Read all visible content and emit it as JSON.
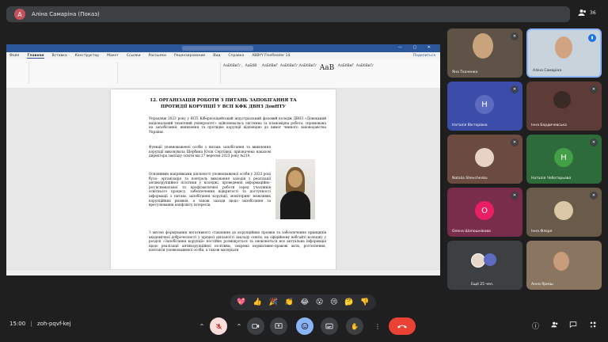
{
  "presenter": {
    "initial": "А",
    "label": "Аліна Самаріна (Показ)"
  },
  "participant_count": "36",
  "word": {
    "tabs": [
      "Файл",
      "Главная",
      "Вставка",
      "Конструктор",
      "Макет",
      "Ссылки",
      "Рассылки",
      "Рецензирование",
      "Вид",
      "Справка",
      "ABBYY FineReader 14"
    ],
    "share_label": "Поделиться",
    "styles": [
      "АаБбВвГг,",
      "АаБбВ",
      "АаБбВвГ",
      "АаБбВвГг,",
      "АаБбВвГг",
      "AaB",
      "АаБбВвГ",
      "АаБбВвГг"
    ],
    "heading_line1": "12. ОРГАНІЗАЦІЯ РОБОТИ З ПИТАНЬ ЗАПОБІГАННЯ ТА",
    "heading_line2": "ПРОТИДІЇ КОРУПЦІЇ У ВСП КФК ДВНЗ ДонНТУ",
    "para1": "Упродовж 2023 року у ВСП Кіберполіцейський індустріальний фаховий коледж ДВНЗ «Донецький національний технічний університет» здійснювалась системна та планомірна робота, спрямована на запобігання, виявлення та протидію корупції відповідно до вимог чинного законодавства України.",
    "para2": "Функції уповноваженої особи з питань запобігання та виявлення корупції виконувала Щербина Юлія Сергіївна, призначена наказом директора закладу освіти від 27 вересня 2023 року №210.",
    "para3": "Основними напрямками діяльності уповноваженої особи у 2023 році було: організація та контроль виконання заходів з реалізації антикорупційної політики у коледжі, проведення інформаційно-роз'яснювальної та профілактичної роботи серед учасників освітнього процесу, забезпечення відкритості та доступності інформації з питань запобігання корупції, моніторинг можливих корупційних ризиків, а також заходи щодо запобігання та врегулювання конфлікту інтересів.",
    "para4": "З метою формування негативного ставлення до корупційних проявів та забезпечення принципів академічної доброчесності у процесі діяльності закладу освіти, на офіційному вебсайті коледжу у розділі «Запобігання корупції» постійно розміщується та оновлюється вся актуальна інформація щодо реалізації антикорупційної політики, зокрема нормативно-правові акти, роз'яснення, контакти уповноваженої особи, а також матеріали"
  },
  "tiles": [
    {
      "name": "Яна Ткаченко",
      "type": "video"
    },
    {
      "name": "Аліна Самаріна",
      "type": "video"
    },
    {
      "name": "Наталія Вікторівна",
      "type": "initial",
      "initial": "H",
      "color": "#5c6bc0"
    },
    {
      "name": "Інна Бердичевська",
      "type": "video"
    },
    {
      "name": "Natalia Shevchenko",
      "type": "photo"
    },
    {
      "name": "Наталія Чеботарьова",
      "type": "initial",
      "initial": "H",
      "color": "#43a047"
    },
    {
      "name": "Олена Шапошнікова",
      "type": "initial",
      "initial": "O",
      "color": "#e91e63"
    },
    {
      "name": "Інна Флоря",
      "type": "photo"
    },
    {
      "name": "Ещё 25 чел.",
      "type": "more"
    },
    {
      "name": "Анна Ярміш",
      "type": "video"
    }
  ],
  "reactions": [
    "💖",
    "👍",
    "🎉",
    "👏",
    "😂",
    "😮",
    "😢",
    "🤔",
    "👎"
  ],
  "bottom": {
    "time": "15:00",
    "separator": "|",
    "meeting_code": "zoh-pqvf-kej"
  },
  "colors": {
    "accent": "#8ab4f8",
    "hangup": "#ea4335",
    "word_blue": "#2b579a"
  }
}
